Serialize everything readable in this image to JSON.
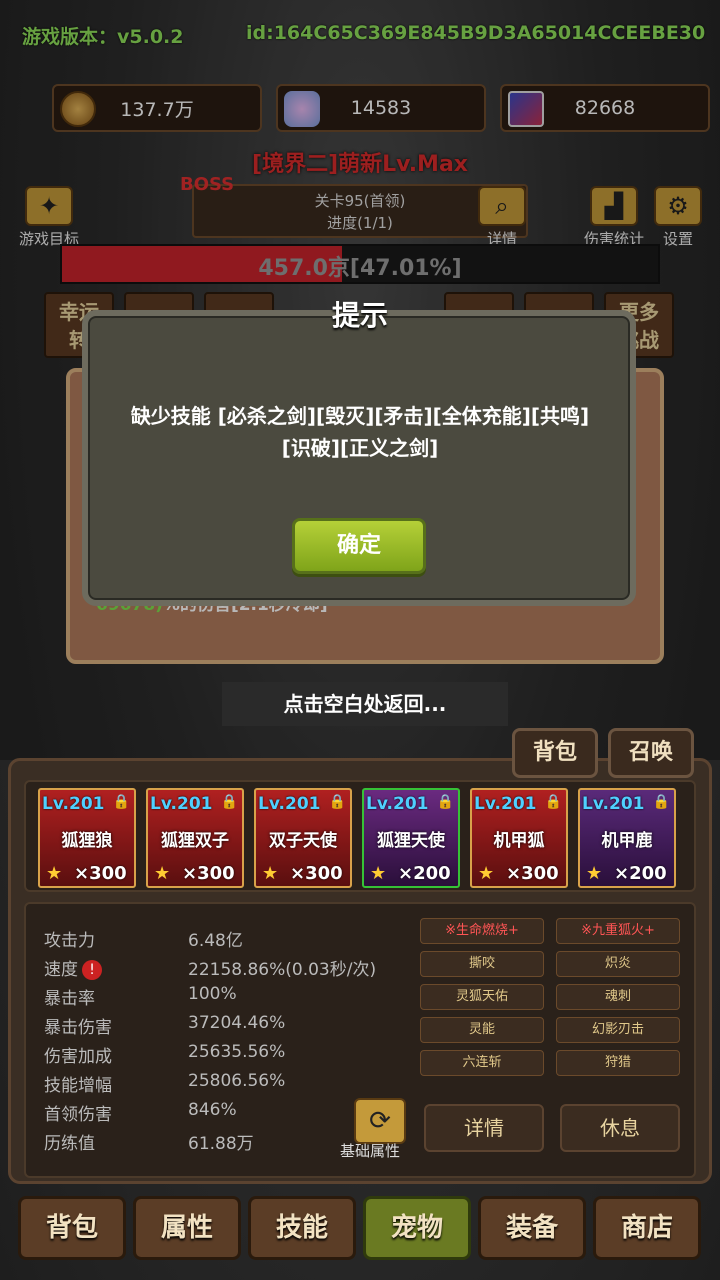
{
  "header": {
    "version": "游戏版本：v5.0.2",
    "uid": "id:164C65C369E845B9D3A65014CCEEBE30"
  },
  "resources": [
    {
      "icon": "coin-icon",
      "value": "137.7万"
    },
    {
      "icon": "crystal-icon",
      "value": "14583"
    },
    {
      "icon": "card-icon",
      "value": "82668"
    }
  ],
  "stage": {
    "title": "[境界二]萌新Lv.Max",
    "boss": "BOSS",
    "level": "关卡95(首领)",
    "progress": "进度(1/1)"
  },
  "side_buttons": {
    "goal": "游戏目标",
    "detail": "详情",
    "damage_stats": "伤害统计",
    "settings": "设置"
  },
  "boss_hp": {
    "text": "457.0京[47.01%]",
    "fraction": 0.4701
  },
  "tabs": [
    {
      "label": "幸运\n转"
    },
    {
      "label": "更多\n挑战"
    }
  ],
  "detail_text": {
    "value": "69678)",
    "suffix": "%的伤害[2.1秒冷却]"
  },
  "return_hint": "点击空白处返回...",
  "dialog": {
    "title": "提示",
    "message_line1": "缺少技能 [必杀之剑][毁灭][矛击][全体充能][共鸣]",
    "message_line2": "[识破][正义之剑]",
    "ok_label": "确定"
  },
  "panel_buttons": {
    "bag": "背包",
    "summon": "召唤"
  },
  "pets": [
    {
      "level": "Lv.201",
      "name": "狐狸狼",
      "count": "×300"
    },
    {
      "level": "Lv.201",
      "name": "狐狸双子",
      "count": "×300"
    },
    {
      "level": "Lv.201",
      "name": "双子天使",
      "count": "×300"
    },
    {
      "level": "Lv.201",
      "name": "狐狸天使",
      "count": "×200"
    },
    {
      "level": "Lv.201",
      "name": "机甲狐",
      "count": "×300"
    },
    {
      "level": "Lv.201",
      "name": "机甲鹿",
      "count": "×200"
    }
  ],
  "stats": [
    {
      "label": "攻击力",
      "value": "6.48亿"
    },
    {
      "label": "速度",
      "value": "22158.86%(0.03秒/次)"
    },
    {
      "label": "暴击率",
      "value": "100%"
    },
    {
      "label": "暴击伤害",
      "value": "37204.46%"
    },
    {
      "label": "伤害加成",
      "value": "25635.56%"
    },
    {
      "label": "技能增幅",
      "value": "25806.56%"
    },
    {
      "label": "首领伤害",
      "value": "846%"
    },
    {
      "label": "历练值",
      "value": "61.88万"
    }
  ],
  "skills": [
    {
      "label": "※生命燃烧+"
    },
    {
      "label": "※九重狐火+"
    },
    {
      "label": "撕咬"
    },
    {
      "label": "炽炎"
    },
    {
      "label": "灵狐天佑"
    },
    {
      "label": "魂刺"
    },
    {
      "label": "灵能"
    },
    {
      "label": "幻影刃击"
    },
    {
      "label": "六连斩"
    },
    {
      "label": "狩猎"
    }
  ],
  "actions": {
    "base_attr": "基础属性",
    "detail": "详情",
    "rest": "休息"
  },
  "nav": [
    {
      "label": "背包"
    },
    {
      "label": "属性"
    },
    {
      "label": "技能"
    },
    {
      "label": "宠物"
    },
    {
      "label": "装备"
    },
    {
      "label": "商店"
    }
  ]
}
